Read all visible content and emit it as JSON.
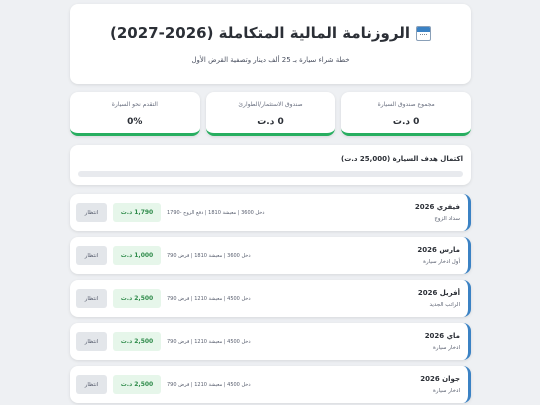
{
  "header": {
    "title": "الروزنامة المالية المتكاملة (2026-2027)",
    "subtitle": "خطة شراء سيارة بـ 25 ألف دينار وتصفية القرض الأول"
  },
  "stats": [
    {
      "label": "مجموع صندوق السيارة",
      "value": "0 د.ت"
    },
    {
      "label": "صندوق الاستثمار/الطوارئ",
      "value": "0 د.ت"
    },
    {
      "label": "التقدم نحو السيارة",
      "value": "0%"
    }
  ],
  "progress": {
    "label": "اكتمال هدف السيارة (25,000 د.ت)",
    "fraction": 0
  },
  "months": [
    {
      "name": "فيفري 2026",
      "note": "سداد الزوج",
      "detail": "دخل 3600 | معيشة 1810 | دفع الزوج -1790",
      "amount": "1,790 د.ت",
      "action": "انتظار"
    },
    {
      "name": "مارس 2026",
      "note": "أول ادخار سيارة",
      "detail": "دخل 3600 | معيشة 1810 | قرض 790",
      "amount": "1,000 د.ت",
      "action": "انتظار"
    },
    {
      "name": "أفريل 2026",
      "note": "الراتب الجديد",
      "detail": "دخل 4500 | معيشة 1210 | قرض 790",
      "amount": "2,500 د.ت",
      "action": "انتظار"
    },
    {
      "name": "ماي 2026",
      "note": "ادخار سيارة",
      "detail": "دخل 4500 | معيشة 1210 | قرض 790",
      "amount": "2,500 د.ت",
      "action": "انتظار"
    },
    {
      "name": "جوان 2026",
      "note": "ادخار سيارة",
      "detail": "دخل 4500 | معيشة 1210 | قرض 790",
      "amount": "2,500 د.ت",
      "action": "انتظار"
    }
  ],
  "colors": {
    "accent_green": "#27ae60",
    "accent_blue": "#3b82c4",
    "amount_bg": "#e6f6ea",
    "page_bg": "#eef0f3"
  },
  "icons": {
    "title_icon": "calendar-icon"
  }
}
